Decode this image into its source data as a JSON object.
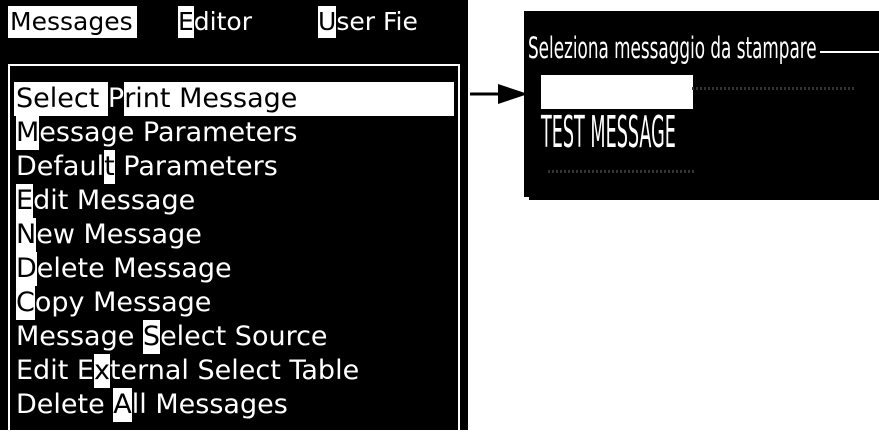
{
  "menubar": {
    "messages": {
      "before": "",
      "hotkey": "",
      "after": "Messages"
    },
    "editor": {
      "hotkey": "E",
      "rest": "ditor"
    },
    "user_files": {
      "hotkey": "U",
      "rest": "ser Fie"
    }
  },
  "menu_items": [
    {
      "pre": "Select ",
      "hot": "P",
      "post": "rint Message",
      "selected": true
    },
    {
      "pre": "",
      "hot": "M",
      "post": "essage Parameters",
      "selected": false
    },
    {
      "pre": "Defaul",
      "hot": "t",
      "post": " Parameters",
      "selected": false
    },
    {
      "pre": "",
      "hot": "E",
      "post": "dit Message",
      "selected": false
    },
    {
      "pre": "",
      "hot": "N",
      "post": "ew Message",
      "selected": false
    },
    {
      "pre": "",
      "hot": "D",
      "post": "elete Message",
      "selected": false
    },
    {
      "pre": "",
      "hot": "C",
      "post": "opy Message",
      "selected": false
    },
    {
      "pre": "Message ",
      "hot": "S",
      "post": "elect Source",
      "selected": false
    },
    {
      "pre": "Edit E",
      "hot": "x",
      "post": "ternal Select Table",
      "selected": false
    },
    {
      "pre": "Delete ",
      "hot": "A",
      "post": "ll Messages",
      "selected": false
    }
  ],
  "dialog": {
    "title": "Seleziona messaggio da stampare",
    "message": "TEST MESSAGE"
  },
  "colors": {
    "background": "#000000",
    "foreground": "#ffffff"
  }
}
